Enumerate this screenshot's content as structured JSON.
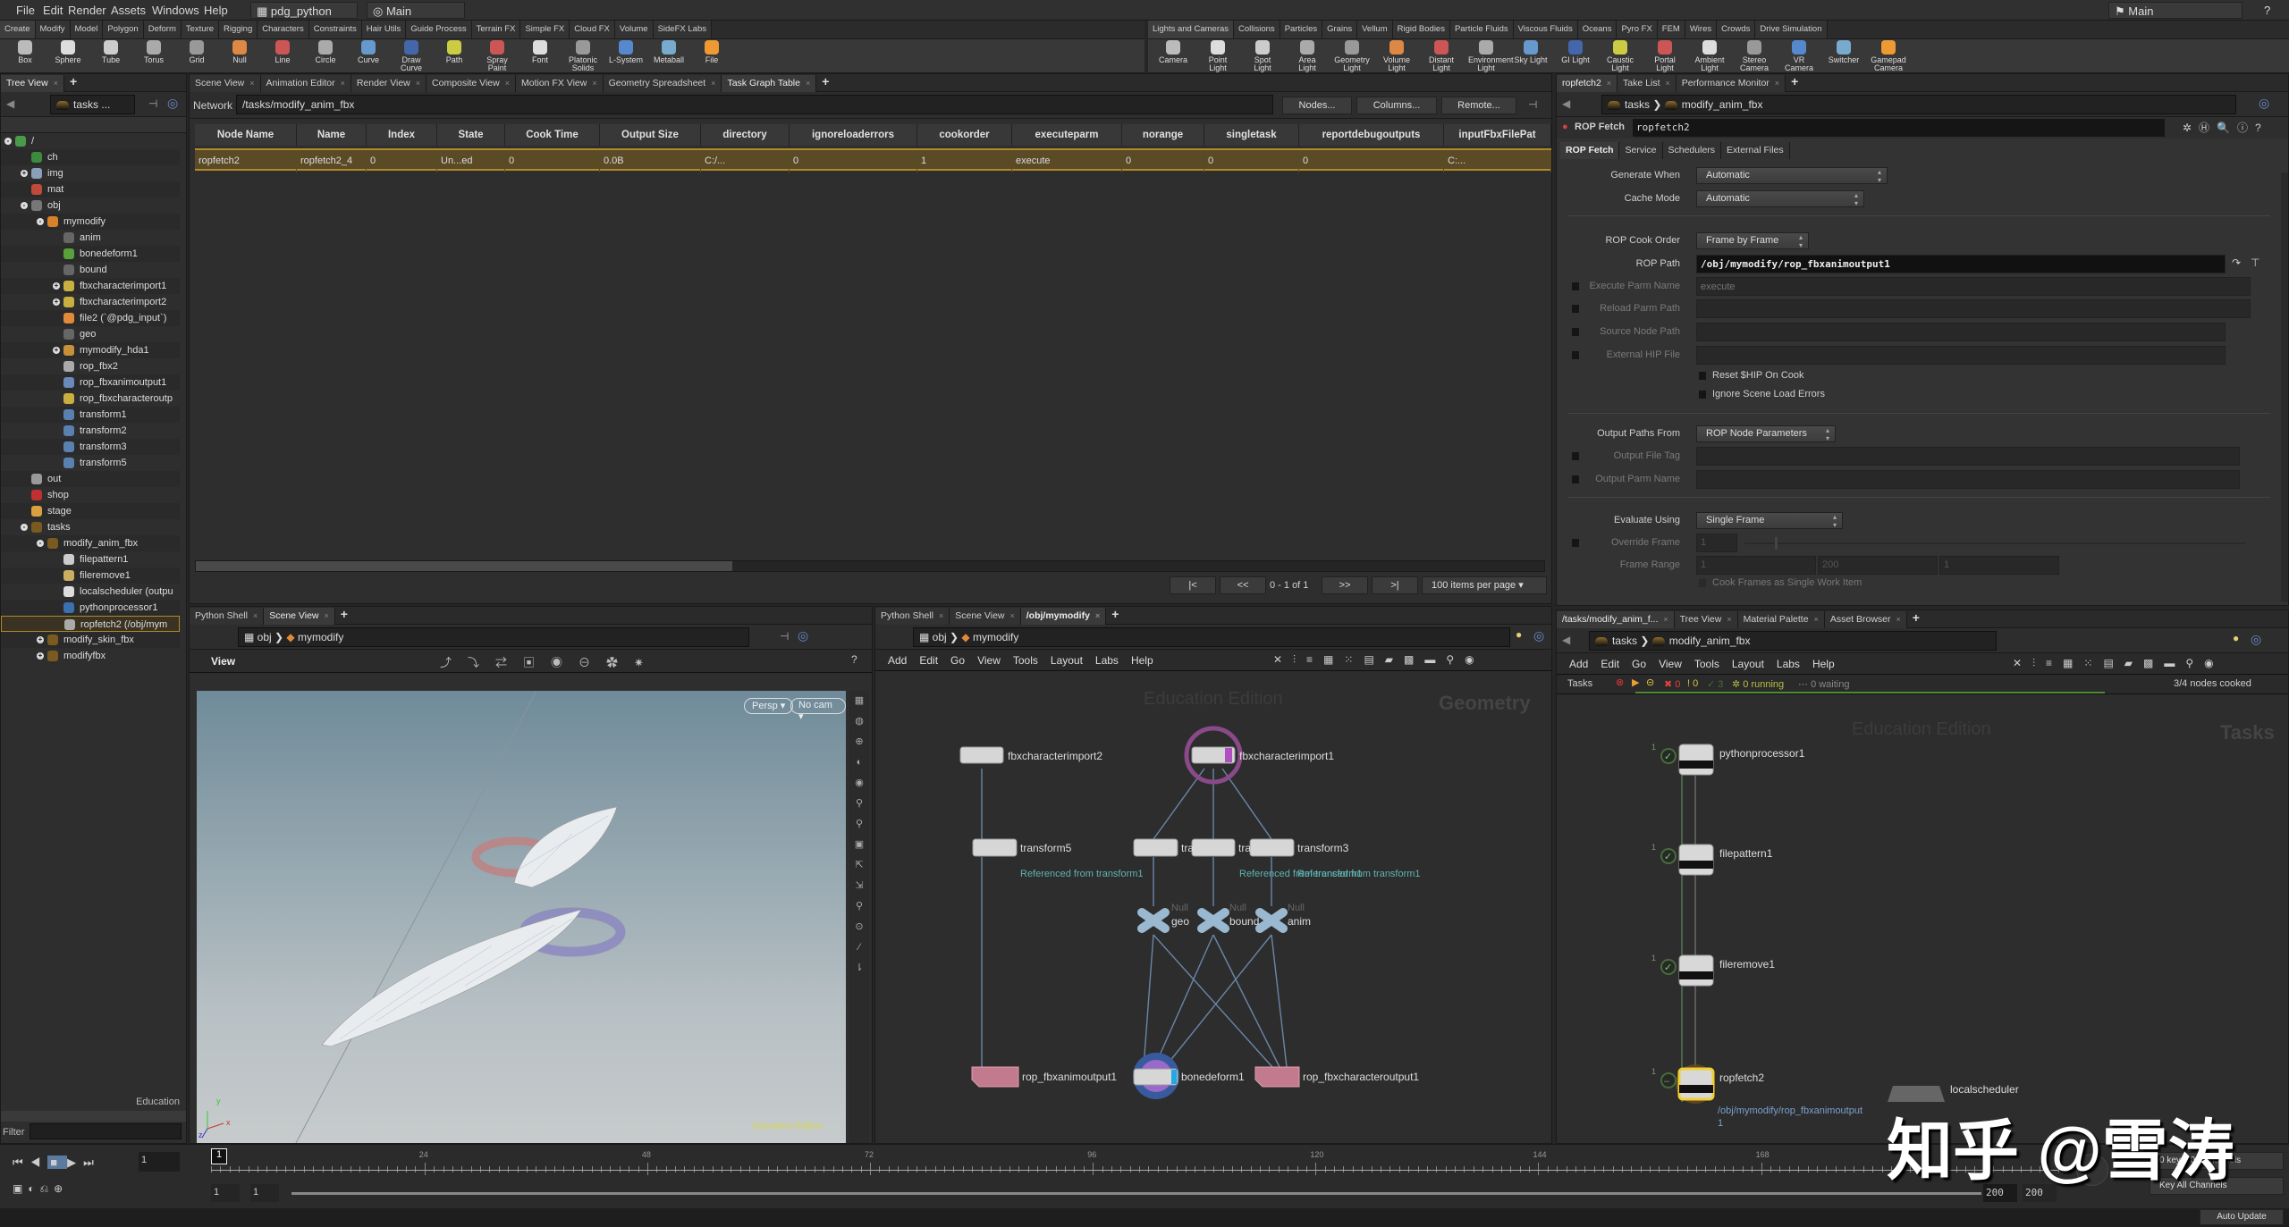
{
  "menubar": {
    "items": [
      "File",
      "Edit",
      "Render",
      "Assets",
      "Windows",
      "Help"
    ],
    "desktop": "pdg_python",
    "context": "Main",
    "right_desktop": "Main",
    "help_icon": "?"
  },
  "shelf_left": {
    "tabs": [
      "Create",
      "Modify",
      "Model",
      "Polygon",
      "Deform",
      "Texture",
      "Rigging",
      "Characters",
      "Constraints",
      "Hair Utils",
      "Guide Process",
      "Terrain FX",
      "Simple FX",
      "Cloud FX",
      "Volume",
      "SideFX Labs"
    ],
    "tools": [
      "Box",
      "Sphere",
      "Tube",
      "Torus",
      "Grid",
      "Null",
      "Line",
      "Circle",
      "Curve",
      "Draw Curve",
      "Path",
      "Spray Paint",
      "Font",
      "Platonic Solids",
      "L-System",
      "Metaball",
      "File"
    ]
  },
  "shelf_right": {
    "tabs": [
      "Lights and Cameras",
      "Collisions",
      "Particles",
      "Grains",
      "Vellum",
      "Rigid Bodies",
      "Particle Fluids",
      "Viscous Fluids",
      "Oceans",
      "Pyro FX",
      "FEM",
      "Wires",
      "Crowds",
      "Drive Simulation"
    ],
    "tools": [
      "Camera",
      "Point Light",
      "Spot Light",
      "Area Light",
      "Geometry Light",
      "Volume Light",
      "Distant Light",
      "Environment Light",
      "Sky Light",
      "GI Light",
      "Caustic Light",
      "Portal Light",
      "Ambient Light",
      "Stereo Camera",
      "VR Camera",
      "Switcher",
      "Gamepad Camera"
    ]
  },
  "tree_pane": {
    "tabs": [
      "Tree View"
    ],
    "path": "tasks",
    "path_more": "...",
    "items": [
      {
        "label": "/",
        "depth": 0,
        "exp": "-",
        "color": "#4a9a4a"
      },
      {
        "label": "ch",
        "depth": 1,
        "exp": "",
        "color": "#3c8a3c"
      },
      {
        "label": "img",
        "depth": 1,
        "exp": "+",
        "color": "#8aa0b8"
      },
      {
        "label": "mat",
        "depth": 1,
        "exp": "",
        "color": "#c04a3a"
      },
      {
        "label": "obj",
        "depth": 1,
        "exp": "-",
        "color": "#777"
      },
      {
        "label": "mymodify",
        "depth": 2,
        "exp": "-",
        "color": "#d8802a"
      },
      {
        "label": "anim",
        "depth": 3,
        "exp": "",
        "color": "#666"
      },
      {
        "label": "bonedeform1",
        "depth": 3,
        "exp": "",
        "color": "#5aa03a"
      },
      {
        "label": "bound",
        "depth": 3,
        "exp": "",
        "color": "#666"
      },
      {
        "label": "fbxcharacterimport1",
        "depth": 3,
        "exp": "+",
        "color": "#c8b040"
      },
      {
        "label": "fbxcharacterimport2",
        "depth": 3,
        "exp": "+",
        "color": "#c8b040"
      },
      {
        "label": "file2 (`@pdg_input`)",
        "depth": 3,
        "exp": "",
        "color": "#e08a3a"
      },
      {
        "label": "geo",
        "depth": 3,
        "exp": "",
        "color": "#666"
      },
      {
        "label": "mymodify_hda1",
        "depth": 3,
        "exp": "+",
        "color": "#c8903a"
      },
      {
        "label": "rop_fbx2",
        "depth": 3,
        "exp": "",
        "color": "#aaa"
      },
      {
        "label": "rop_fbxanimoutput1",
        "depth": 3,
        "exp": "",
        "color": "#6a8ab8"
      },
      {
        "label": "rop_fbxcharacteroutp",
        "depth": 3,
        "exp": "",
        "color": "#c8b040"
      },
      {
        "label": "transform1",
        "depth": 3,
        "exp": "",
        "color": "#5a80b0"
      },
      {
        "label": "transform2",
        "depth": 3,
        "exp": "",
        "color": "#5a80b0"
      },
      {
        "label": "transform3",
        "depth": 3,
        "exp": "",
        "color": "#5a80b0"
      },
      {
        "label": "transform5",
        "depth": 3,
        "exp": "",
        "color": "#5a80b0"
      },
      {
        "label": "out",
        "depth": 1,
        "exp": "",
        "color": "#999"
      },
      {
        "label": "shop",
        "depth": 1,
        "exp": "",
        "color": "#c03030"
      },
      {
        "label": "stage",
        "depth": 1,
        "exp": "",
        "color": "#d8a040"
      },
      {
        "label": "tasks",
        "depth": 1,
        "exp": "-",
        "color": "#7a5a20"
      },
      {
        "label": "modify_anim_fbx",
        "depth": 2,
        "exp": "-",
        "color": "#7a5a20"
      },
      {
        "label": "filepattern1",
        "depth": 3,
        "exp": "",
        "color": "#ccc"
      },
      {
        "label": "fileremove1",
        "depth": 3,
        "exp": "",
        "color": "#c8b060"
      },
      {
        "label": "localscheduler (outpu",
        "depth": 3,
        "exp": "",
        "color": "#ddd"
      },
      {
        "label": "pythonprocessor1",
        "depth": 3,
        "exp": "",
        "color": "#3a70b0"
      },
      {
        "label": "ropfetch2 (/obj/mym",
        "depth": 3,
        "exp": "",
        "color": "#aaa",
        "selected": true
      },
      {
        "label": "modify_skin_fbx",
        "depth": 2,
        "exp": "+",
        "color": "#7a5a20"
      },
      {
        "label": "modifyfbx",
        "depth": 2,
        "exp": "+",
        "color": "#7a5a20"
      }
    ],
    "footer": "Education",
    "filter_label": "Filter"
  },
  "task_table": {
    "tabs": [
      "Scene View",
      "Animation Editor",
      "Render View",
      "Composite View",
      "Motion FX View",
      "Geometry Spreadsheet",
      "Task Graph Table"
    ],
    "active_tab": 6,
    "network_label": "Network",
    "network_path": "/tasks/modify_anim_fbx",
    "buttons": [
      "Nodes...",
      "Columns...",
      "Remote..."
    ],
    "columns": [
      "Node Name",
      "Name",
      "Index",
      "State",
      "Cook Time",
      "Output Size",
      "directory",
      "ignoreloaderrors",
      "cookorder",
      "executeparm",
      "norange",
      "singletask",
      "reportdebugoutputs",
      "inputFbxFilePat"
    ],
    "rows": [
      [
        "ropfetch2",
        "ropfetch2_4",
        "0",
        "Un...ed",
        "0",
        "0.0B",
        "C:/...",
        "0",
        "1",
        "execute",
        "0",
        "0",
        "0",
        "C:..."
      ]
    ],
    "pager": {
      "first": "|<",
      "prev": "<<",
      "range": "0 - 1 of 1",
      "next": ">>",
      "last": ">|",
      "per_page": "100 items per page"
    }
  },
  "params": {
    "tabs": [
      "ropfetch2",
      "Take List",
      "Performance Monitor"
    ],
    "path": [
      "tasks",
      "modify_anim_fbx"
    ],
    "node_type": "ROP Fetch",
    "node_name": "ropfetch2",
    "sub_tabs": [
      "ROP Fetch",
      "Service",
      "Schedulers",
      "External Files"
    ],
    "generate_when": {
      "label": "Generate When",
      "value": "Automatic"
    },
    "cache_mode": {
      "label": "Cache Mode",
      "value": "Automatic"
    },
    "rop_cook_order": {
      "label": "ROP Cook Order",
      "value": "Frame by Frame"
    },
    "rop_path": {
      "label": "ROP Path",
      "value": "/obj/mymodify/rop_fbxanimoutput1"
    },
    "execute_parm_name": {
      "label": "Execute Parm Name",
      "placeholder": "execute"
    },
    "reload_parm_path": {
      "label": "Reload Parm Path"
    },
    "source_node_path": {
      "label": "Source Node Path"
    },
    "external_hip_file": {
      "label": "External HIP File"
    },
    "reset_hip": "Reset $HIP On Cook",
    "ignore_errors": "Ignore Scene Load Errors",
    "output_paths_from": {
      "label": "Output Paths From",
      "value": "ROP Node Parameters"
    },
    "output_file_tag": {
      "label": "Output File Tag"
    },
    "output_parm_name": {
      "label": "Output Parm Name"
    },
    "evaluate_using": {
      "label": "Evaluate Using",
      "value": "Single Frame"
    },
    "override_frame": {
      "label": "Override Frame",
      "value": "1"
    },
    "frame_range": {
      "label": "Frame Range",
      "start": "1",
      "end": "200",
      "inc": "1"
    },
    "cook_single": "Cook Frames as Single Work Item"
  },
  "scene_view": {
    "tabs": [
      "Python Shell",
      "Scene View"
    ],
    "path": [
      "obj",
      "mymodify"
    ],
    "view_label": "View",
    "persp": "Persp",
    "cam": "No cam",
    "watermark": "Education Edition",
    "axes": [
      "x",
      "y",
      "z"
    ]
  },
  "net_view": {
    "tabs": [
      "Python Shell",
      "Scene View",
      "/obj/mymodify"
    ],
    "path": [
      "obj",
      "mymodify"
    ],
    "menu": [
      "Add",
      "Edit",
      "Go",
      "View",
      "Tools",
      "Layout",
      "Labs",
      "Help"
    ],
    "watermark": "Education Edition",
    "context": "Geometry",
    "nodes": {
      "fbx2": "fbxcharacterimport2",
      "fbx1": "fbxcharacterimport1",
      "t5": "transform5",
      "t1": "tra",
      "t2": "tra",
      "t3": "transform3",
      "geo": "geo",
      "bound": "bound",
      "anim": "anim",
      "null_type": "Null",
      "rop_anim": "rop_fbxanimoutput1",
      "bone": "bonedeform1",
      "rop_char": "rop_fbxcharacteroutput1"
    },
    "ref_note": "Referenced from transform1"
  },
  "tasks_view": {
    "tabs": [
      "/tasks/modify_anim_f...",
      "Tree View",
      "Material Palette",
      "Asset Browser"
    ],
    "path": [
      "tasks",
      "modify_anim_fbx"
    ],
    "menu": [
      "Add",
      "Edit",
      "Go",
      "View",
      "Tools",
      "Layout",
      "Labs",
      "Help"
    ],
    "status": {
      "label": "Tasks",
      "failed": "0",
      "warnings": "0",
      "done": "3",
      "running": "0 running",
      "waiting": "0 waiting",
      "cooked": "3/4 nodes cooked",
      "progress": 0.75
    },
    "watermark": "Education Edition",
    "context": "Tasks",
    "nodes": [
      "pythonprocessor1",
      "filepattern1",
      "fileremove1",
      "ropfetch2"
    ],
    "counts": [
      "1",
      "1",
      "1",
      "1"
    ],
    "rop_note": "/obj/mymodify/rop_fbxanimoutput",
    "rop_note2": "1",
    "scheduler": "localscheduler"
  },
  "timeline": {
    "current_frame": "1",
    "ticks": [
      "24",
      "48",
      "72",
      "96",
      "120",
      "144",
      "168",
      "192"
    ],
    "range_start": "1",
    "range_start2": "1",
    "range_end": "200",
    "range_end2": "200",
    "keys": "0 keys, 0/0 channels",
    "key_all": "Key All Channels",
    "auto_update": "Auto Update"
  },
  "overlay_watermark": "知乎 @雪涛",
  "colors": {
    "accent": "#b08a2a",
    "selected_row": "#5a4a26",
    "node_pink": "#c27a8e",
    "progress": "#4f8a35"
  }
}
